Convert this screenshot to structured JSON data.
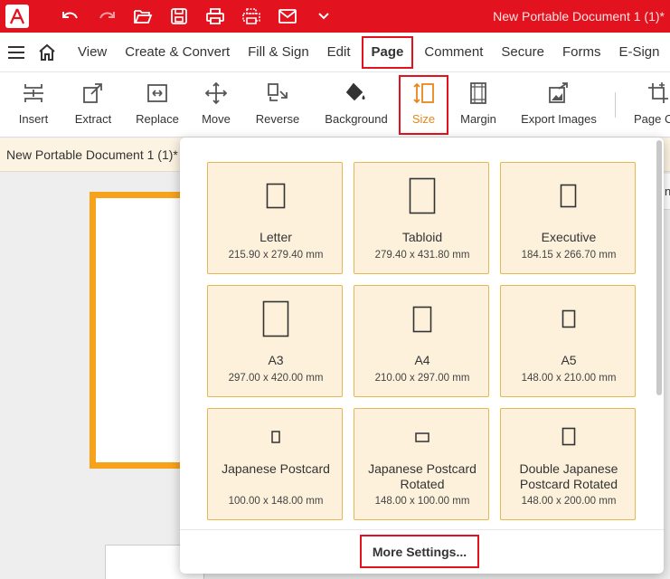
{
  "titlebar": {
    "app_icon": "acrobat-a-icon",
    "quick_actions": [
      "undo-icon",
      "redo-icon",
      "open-folder-icon",
      "save-icon",
      "print-icon",
      "scan-print-icon",
      "email-icon",
      "chevron-down-icon"
    ],
    "document_title": "New Portable Document 1 (1)*",
    "accent_color": "#e2121e"
  },
  "menu": {
    "items": [
      {
        "label": "View"
      },
      {
        "label": "Create & Convert"
      },
      {
        "label": "Fill & Sign"
      },
      {
        "label": "Edit"
      },
      {
        "label": "Page",
        "active": true
      },
      {
        "label": "Comment"
      },
      {
        "label": "Secure"
      },
      {
        "label": "Forms"
      },
      {
        "label": "E-Sign"
      }
    ]
  },
  "toolbar": {
    "tools": [
      {
        "label": "Insert",
        "icon": "insert-page-icon"
      },
      {
        "label": "Extract",
        "icon": "extract-page-icon"
      },
      {
        "label": "Replace",
        "icon": "replace-page-icon"
      },
      {
        "label": "Move",
        "icon": "move-arrows-icon"
      },
      {
        "label": "Reverse",
        "icon": "reverse-pages-icon"
      },
      {
        "label": "Background",
        "icon": "paint-bucket-icon"
      },
      {
        "label": "Size",
        "icon": "page-size-icon",
        "active": true
      },
      {
        "label": "Margin",
        "icon": "page-margin-icon"
      },
      {
        "label": "Export Images",
        "icon": "export-images-icon"
      },
      {
        "label": "Page C",
        "icon": "page-crop-icon"
      }
    ]
  },
  "document_tab": {
    "label": "New Portable Document 1 (1)*"
  },
  "right_stub_text": "nt",
  "page_sizes": [
    {
      "name": "Letter",
      "dims": "215.90 x 279.40 mm"
    },
    {
      "name": "Tabloid",
      "dims": "279.40 x 431.80 mm"
    },
    {
      "name": "Executive",
      "dims": "184.15 x 266.70 mm"
    },
    {
      "name": "A3",
      "dims": "297.00 x 420.00 mm"
    },
    {
      "name": "A4",
      "dims": "210.00 x 297.00 mm"
    },
    {
      "name": "A5",
      "dims": "148.00 x 210.00 mm"
    },
    {
      "name": "Japanese Postcard",
      "dims": "100.00 x 148.00 mm"
    },
    {
      "name": "Japanese Postcard Rotated",
      "dims": "148.00 x 100.00 mm"
    },
    {
      "name": "Double Japanese Postcard Rotated",
      "dims": "148.00 x 200.00 mm"
    }
  ],
  "more_settings_label": "More Settings...",
  "colors": {
    "card_bg": "#fdf1dc",
    "card_border": "#e8b74f",
    "selection": "#f7a21b",
    "size_icon": "#e8861a"
  }
}
